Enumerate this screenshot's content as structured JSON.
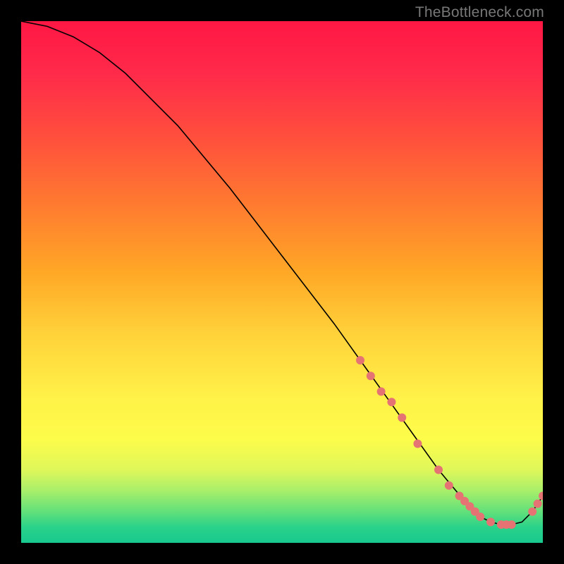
{
  "watermark": "TheBottleneck.com",
  "chart_data": {
    "type": "line",
    "title": "",
    "xlabel": "",
    "ylabel": "",
    "xlim": [
      0,
      100
    ],
    "ylim": [
      0,
      100
    ],
    "grid": false,
    "legend": false,
    "series": [
      {
        "name": "curve",
        "style": "line",
        "color": "#000000",
        "x": [
          0,
          5,
          10,
          15,
          20,
          30,
          40,
          50,
          60,
          65,
          70,
          75,
          80,
          85,
          88,
          90,
          92,
          94,
          96,
          98,
          100
        ],
        "values": [
          100,
          99,
          97,
          94,
          90,
          80,
          68,
          55,
          42,
          35,
          28,
          21,
          14,
          8,
          5,
          4,
          3.5,
          3.5,
          4,
          6,
          9
        ]
      },
      {
        "name": "highlight-points",
        "style": "scatter",
        "color": "#e57373",
        "x": [
          65,
          67,
          69,
          71,
          73,
          76,
          80,
          82,
          84,
          85,
          86,
          87,
          88,
          90,
          92,
          93,
          94,
          98,
          99,
          100
        ],
        "values": [
          35,
          32,
          29,
          27,
          24,
          19,
          14,
          11,
          9,
          8,
          7,
          6,
          5,
          4,
          3.5,
          3.5,
          3.5,
          6,
          7.5,
          9
        ]
      }
    ],
    "background_gradient": {
      "orientation": "vertical",
      "stops": [
        {
          "pct": 0,
          "color": "#ff1744"
        },
        {
          "pct": 35,
          "color": "#ff7a30"
        },
        {
          "pct": 60,
          "color": "#ffd23a"
        },
        {
          "pct": 80,
          "color": "#fdfc4a"
        },
        {
          "pct": 94,
          "color": "#62e07a"
        },
        {
          "pct": 100,
          "color": "#18c88e"
        }
      ]
    }
  }
}
